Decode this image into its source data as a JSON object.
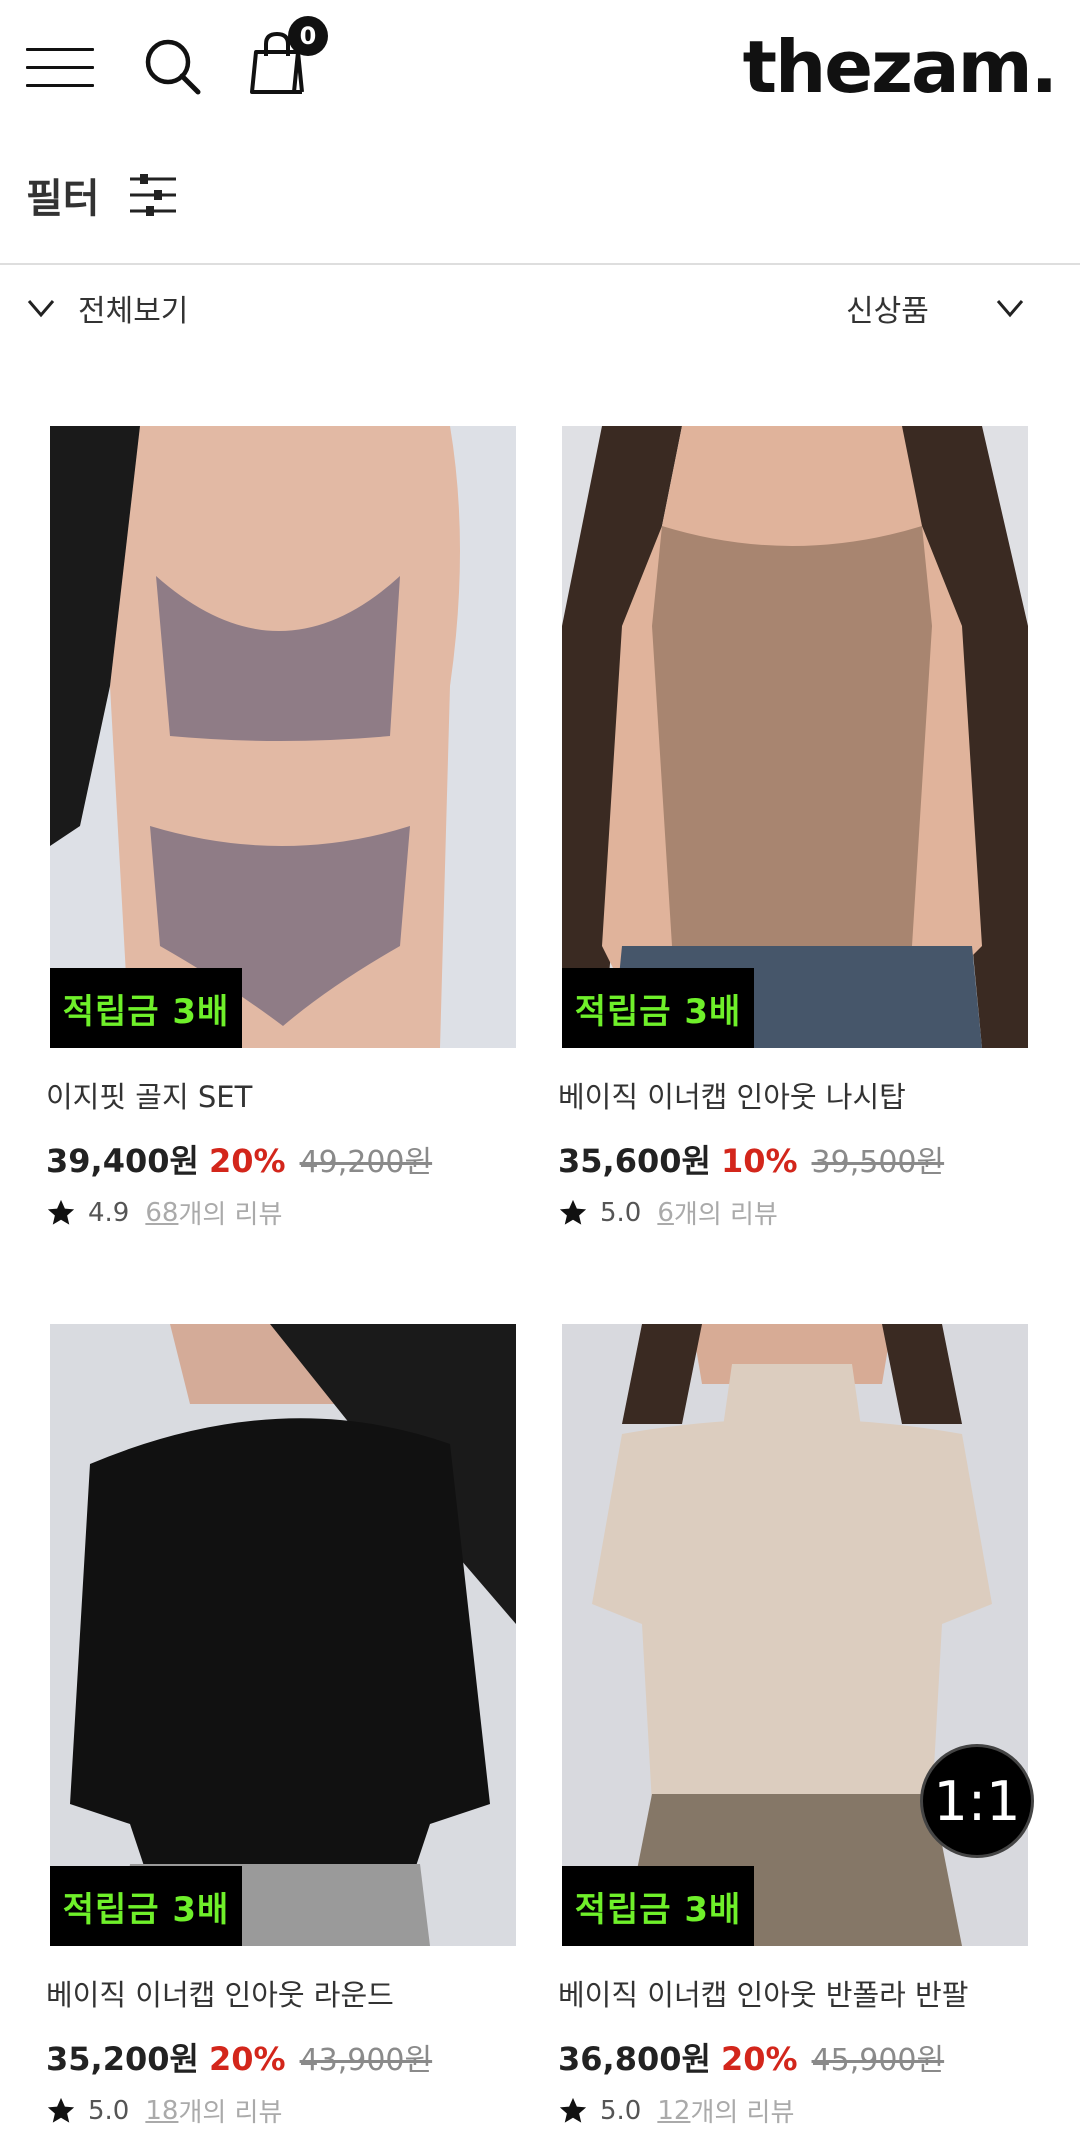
{
  "header": {
    "logo": "thezam.",
    "cart_count": "0"
  },
  "filter": {
    "label": "필터"
  },
  "category": {
    "label": "전체보기"
  },
  "sort": {
    "label": "신상품"
  },
  "products": [
    {
      "name": "이지핏 골지 SET",
      "price": "39,400원",
      "discount": "20%",
      "original_price": "49,200원",
      "badge": "적립금 3배",
      "rating": "4.9",
      "review_count": "68",
      "review_text": "개의 리뷰",
      "image_color": "#8f7c86"
    },
    {
      "name": "베이직 이너캡 인아웃 나시탑",
      "price": "35,600원",
      "discount": "10%",
      "original_price": "39,500원",
      "badge": "적립금 3배",
      "rating": "5.0",
      "review_count": "6",
      "review_text": "개의 리뷰",
      "image_color": "#a88570"
    },
    {
      "name": "베이직 이너캡 인아웃 라운드",
      "price": "35,200원",
      "discount": "20%",
      "original_price": "43,900원",
      "badge": "적립금 3배",
      "rating": "5.0",
      "review_count": "18",
      "review_text": "개의 리뷰",
      "image_color": "#111111"
    },
    {
      "name": "베이직 이너캡 인아웃 반폴라 반팔",
      "price": "36,800원",
      "discount": "20%",
      "original_price": "45,900원",
      "badge": "적립금 3배",
      "rating": "5.0",
      "review_count": "12",
      "review_text": "개의 리뷰",
      "image_color": "#dccdbf"
    }
  ],
  "chat": {
    "label": "1:1"
  }
}
